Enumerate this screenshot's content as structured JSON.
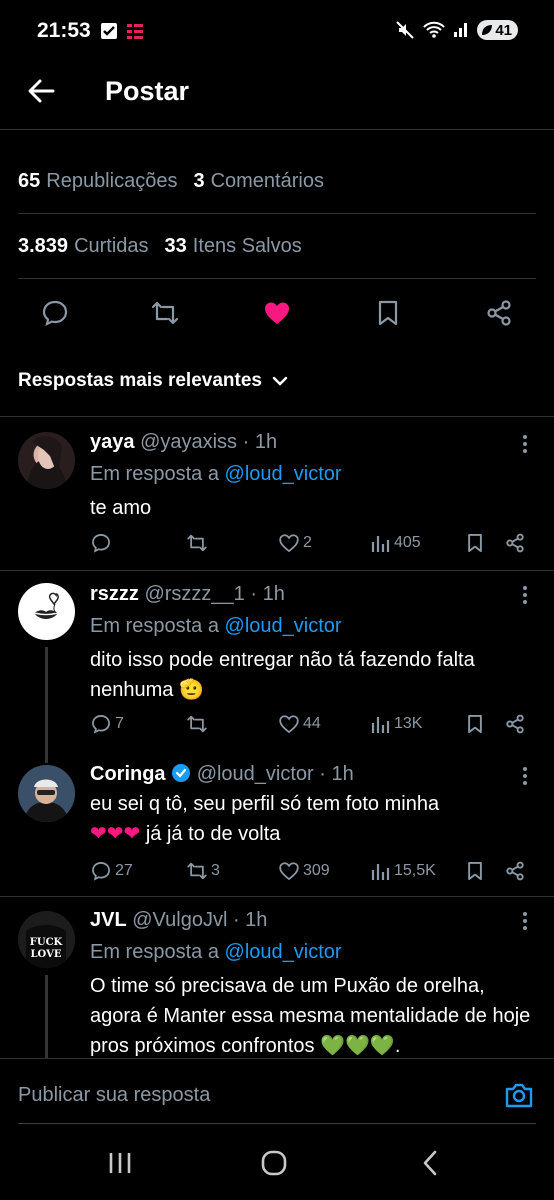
{
  "status_bar": {
    "time": "21:53",
    "battery": "41"
  },
  "header": {
    "title": "Postar"
  },
  "stats": {
    "reposts_count": "65",
    "reposts_label": "Republicações",
    "comments_count": "3",
    "comments_label": "Comentários",
    "likes_count": "3.839",
    "likes_label": "Curtidas",
    "saves_count": "33",
    "saves_label": "Itens Salvos"
  },
  "section": {
    "heading": "Respostas mais relevantes"
  },
  "replies": [
    {
      "name": "yaya",
      "handle": "@yayaxiss",
      "time": "· 1h",
      "reply_to_prefix": "Em resposta a",
      "reply_to_handle": "@loud_victor",
      "text": "te amo",
      "likes": "2",
      "views": "405",
      "reposts": "",
      "comments": ""
    },
    {
      "name": "rszzz",
      "handle": "@rszzz__1",
      "time": "· 1h",
      "reply_to_prefix": "Em resposta a",
      "reply_to_handle": "@loud_victor",
      "text": "dito isso pode entregar não tá fazendo falta nenhuma",
      "emoji": "🫡",
      "comments": "7",
      "likes": "44",
      "views": "13K",
      "reposts": ""
    },
    {
      "name": "Coringa",
      "handle": "@loud_victor",
      "time": "· 1h",
      "text_line1": "eu sei q tô, seu perfil só tem foto minha",
      "hearts": "❤❤❤",
      "text_line2": "já já to de volta",
      "comments": "27",
      "reposts": "3",
      "likes": "309",
      "views": "15,5K"
    },
    {
      "name": "JVL",
      "handle": "@VulgoJvl",
      "time": "· 1h",
      "reply_to_prefix": "Em resposta a",
      "reply_to_handle": "@loud_victor",
      "text": "O time só precisava de um Puxão de orelha, agora é Manter essa mesma mentalidade de hoje pros próximos confrontos",
      "hearts": "💚💚💚",
      "avatar_text_1": "FUCK",
      "avatar_text_2": "LOVE"
    }
  ],
  "compose": {
    "placeholder": "Publicar sua resposta"
  },
  "colors": {
    "accent": "#1d9bf0",
    "like": "#f91880",
    "muted": "#8b98a5",
    "background": "#000000"
  }
}
